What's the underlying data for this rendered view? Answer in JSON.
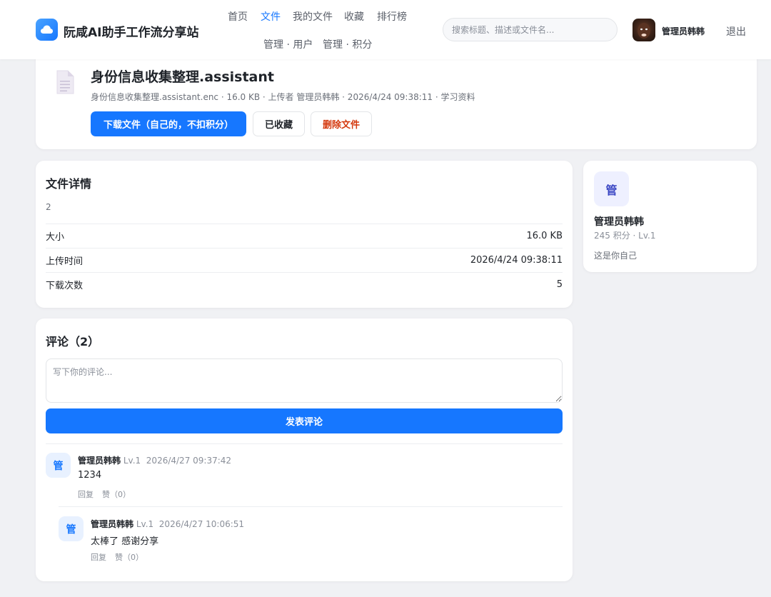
{
  "header": {
    "site_title": "阮咸AI助手工作流分享站",
    "nav": {
      "home": "首页",
      "files": "文件",
      "my_files": "我的文件",
      "favorites": "收藏",
      "leaderboard": "排行榜",
      "admin_users": "管理 · 用户",
      "admin_points": "管理 · 积分"
    },
    "active_nav": "文件",
    "search_placeholder": "搜索标题、描述或文件名...",
    "user_name": "管理员韩韩",
    "logout": "退出",
    "brand_color": "#1677ff"
  },
  "file": {
    "title": "身份信息收集整理.assistant",
    "meta": "身份信息收集整理.assistant.enc · 16.0 KB · 上传者 管理员韩韩 · 2026/4/24 09:38:11 · 学习资料",
    "download_label": "下载文件（自己的，不扣积分）",
    "favorite_label": "已收藏",
    "delete_label": "删除文件"
  },
  "details": {
    "title": "文件详情",
    "description": "2",
    "rows": [
      {
        "label": "大小",
        "value": "16.0 KB"
      },
      {
        "label": "上传时间",
        "value": "2026/4/24 09:38:11"
      },
      {
        "label": "下载次数",
        "value": "5"
      }
    ]
  },
  "uploader": {
    "avatar_char": "管",
    "name": "管理员韩韩",
    "score": "245 积分 · Lv.1",
    "note": "这是你自己"
  },
  "comments": {
    "title": "评论（2）",
    "input_placeholder": "写下你的评论...",
    "post_label": "发表评论",
    "items": [
      {
        "avatar_char": "管",
        "name": "管理员韩韩",
        "level": "Lv.1",
        "time": "2026/4/27 09:37:42",
        "text": "1234",
        "reply": "回复",
        "like": "赞（0）"
      },
      {
        "avatar_char": "管",
        "name": "管理员韩韩",
        "level": "Lv.1",
        "time": "2026/4/27 10:06:51",
        "text": "太棒了 感谢分享",
        "reply": "回复",
        "like": "赞（0）"
      }
    ]
  }
}
